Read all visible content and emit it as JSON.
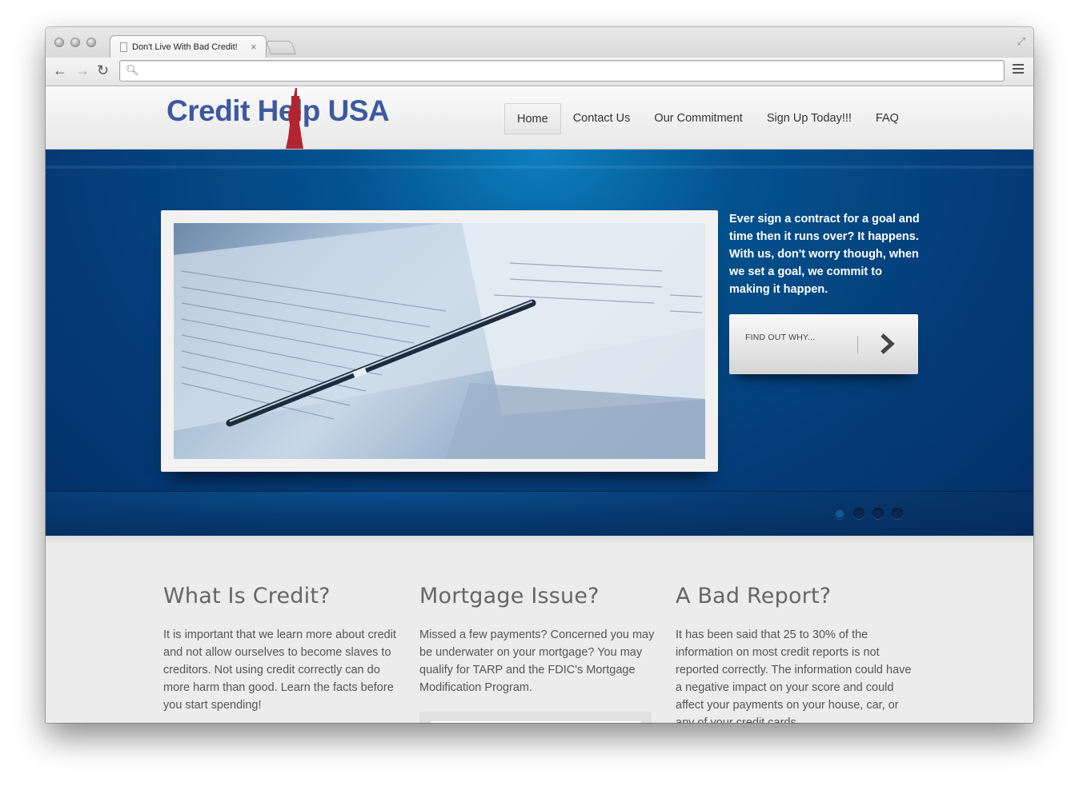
{
  "browser": {
    "tab_title": "Don't Live With Bad Credit!",
    "address": ""
  },
  "site": {
    "logo_text": "Credit Help USA",
    "nav": [
      {
        "label": "Home",
        "active": true
      },
      {
        "label": "Contact Us"
      },
      {
        "label": "Our Commitment"
      },
      {
        "label": "Sign Up Today!!!"
      },
      {
        "label": "FAQ"
      }
    ],
    "hero": {
      "text": "Ever sign a contract for a goal and time then it runs over? It happens. With us, don't worry though, when we set a goal, we commit to making it happen.",
      "cta_label": "FIND OUT WHY...",
      "slides": 4,
      "active_slide": 1
    },
    "columns": [
      {
        "title": "What Is Credit?",
        "body": "It is important that we learn more about credit and not allow ourselves to become slaves to creditors. Not using credit correctly can do more harm than good. Learn the facts before you start spending!"
      },
      {
        "title": "Mortgage Issue?",
        "body": "Missed a few payments? Concerned you may be underwater on your mortgage? You may qualify for TARP and the FDIC's Mortgage Modification Program."
      },
      {
        "title": "A Bad Report?",
        "body": "It has been said that 25 to 30% of the information on most credit reports is not reported correctly. The information could have a negative impact on your score and could affect your payments on your house, car, or any of your credit cards."
      }
    ]
  },
  "colors": {
    "logo_blue": "#3d5a9f",
    "statue_red": "#b3252e",
    "hero_blue": "#043f7c"
  }
}
